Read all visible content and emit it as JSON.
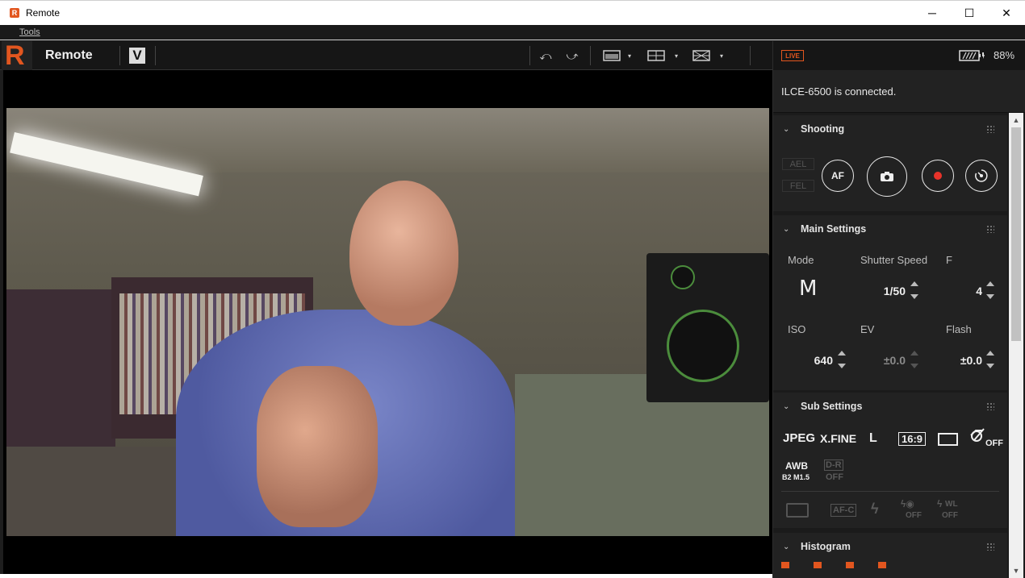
{
  "window": {
    "title": "Remote",
    "app_icon_letter": "R",
    "minimize": "─",
    "maximize": "☐",
    "close": "✕"
  },
  "menu": {
    "tools": "Tools"
  },
  "toolbar": {
    "logo_letter": "R",
    "app_name": "Remote",
    "v_label": "V",
    "rotate_left": "⤺",
    "rotate_right": "⤻"
  },
  "panel": {
    "live_badge": "LIVE",
    "battery_percent": "88%",
    "status": "ILCE-6500 is connected.",
    "shooting": {
      "title": "Shooting",
      "ael": "AEL",
      "fel": "FEL",
      "af": "AF"
    },
    "main_settings": {
      "title": "Main Settings",
      "mode_label": "Mode",
      "mode_value": "M",
      "shutter_label": "Shutter Speed",
      "shutter_value": "1/50",
      "f_label": "F",
      "f_value": "4",
      "iso_label": "ISO",
      "iso_value": "640",
      "ev_label": "EV",
      "ev_value": "±0.0",
      "flash_label": "Flash",
      "flash_value": "±0.0"
    },
    "sub_settings": {
      "title": "Sub Settings",
      "file_format": "JPEG",
      "quality": "X.FINE",
      "image_size": "L",
      "aspect": "16:9",
      "awb": "AWB",
      "awb_sub": "B2  M1.5",
      "dro_top": "D-R",
      "dro_bottom": "OFF",
      "focus_mode": "AF-C",
      "off": "OFF",
      "wl": "WL"
    },
    "histogram": {
      "title": "Histogram"
    }
  }
}
